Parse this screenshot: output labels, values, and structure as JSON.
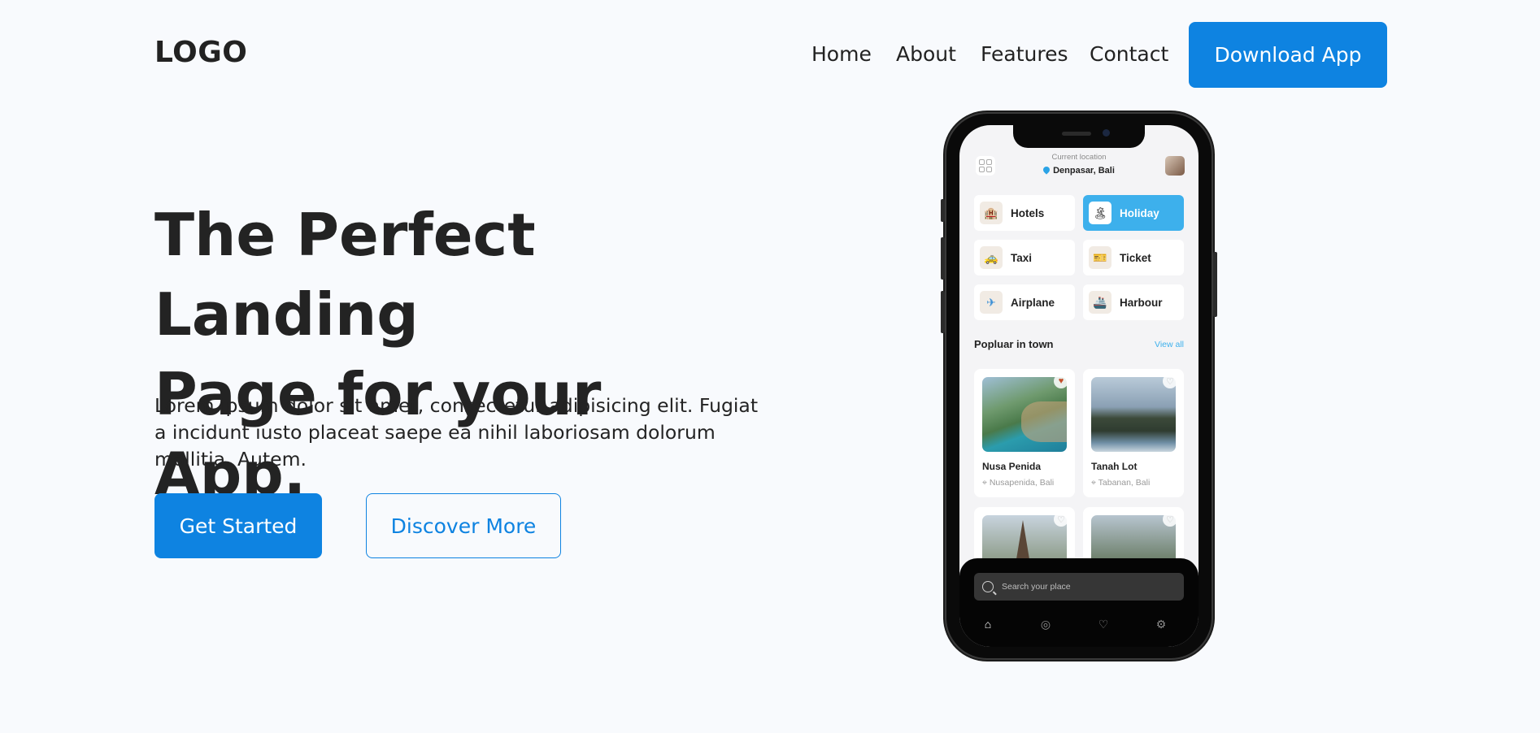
{
  "nav": {
    "logo": "LOGO",
    "links": [
      "Home",
      "About",
      "Features",
      "Contact"
    ],
    "cta": "Download App"
  },
  "hero": {
    "title_line1": "The Perfect Landing",
    "title_line2": "Page for your App.",
    "description": "Lorem ipsum dolor sit amet, consectetur adipisicing elit. Fugiat a incidunt iusto placeat saepe ea nihil laboriosam dolorum mollitia. Autem.",
    "primary_button": "Get Started",
    "secondary_button": "Discover More"
  },
  "phone": {
    "location_label": "Current location",
    "location": "Denpasar, Bali",
    "categories": [
      {
        "label": "Hotels",
        "icon": "hotel-icon",
        "active": false
      },
      {
        "label": "Holiday",
        "icon": "palm-tree-icon",
        "active": true
      },
      {
        "label": "Taxi",
        "icon": "taxi-icon",
        "active": false
      },
      {
        "label": "Ticket",
        "icon": "ticket-icon",
        "active": false
      },
      {
        "label": "Airplane",
        "icon": "airplane-icon",
        "active": false
      },
      {
        "label": "Harbour",
        "icon": "ship-icon",
        "active": false
      }
    ],
    "section_title": "Popluar in town",
    "view_all": "View all",
    "places": [
      {
        "name": "Nusa Penida",
        "location": "Nusapenida, Bali",
        "favorite": true
      },
      {
        "name": "Tanah Lot",
        "location": "Tabanan, Bali",
        "favorite": false
      }
    ],
    "search_placeholder": "Search your place",
    "tabs": [
      "home-icon",
      "compass-icon",
      "heart-icon",
      "settings-icon"
    ],
    "accent": "#3db0ec"
  },
  "colors": {
    "primary": "#0e83e1",
    "background": "#f8fafd",
    "text": "#232323"
  }
}
